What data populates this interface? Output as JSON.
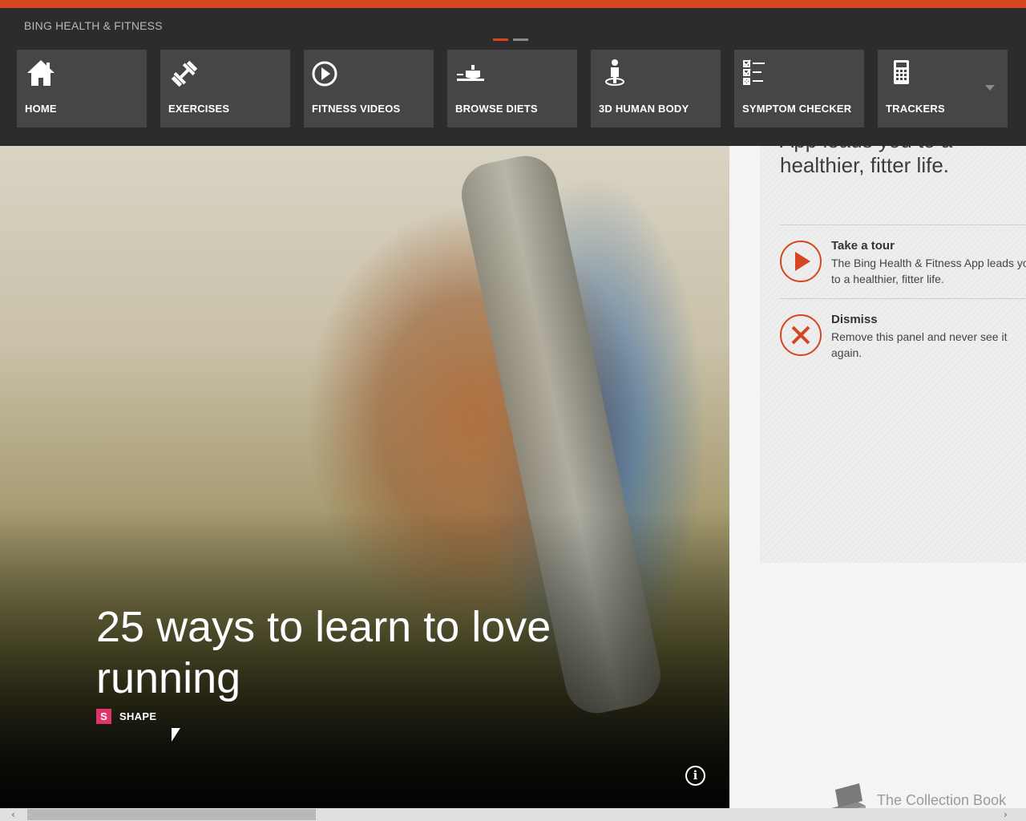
{
  "app": {
    "title": "BING HEALTH & FITNESS"
  },
  "colors": {
    "accent": "#d6451f",
    "appbar": "#2c2c2c",
    "tile": "#464646",
    "source_badge": "#e0336a"
  },
  "nav": {
    "items": [
      {
        "label": "HOME",
        "icon": "home-icon"
      },
      {
        "label": "EXERCISES",
        "icon": "dumbbell-icon"
      },
      {
        "label": "FITNESS VIDEOS",
        "icon": "play-circle-icon"
      },
      {
        "label": "BROWSE DIETS",
        "icon": "food-plate-icon"
      },
      {
        "label": "3D HUMAN BODY",
        "icon": "human-body-icon"
      },
      {
        "label": "SYMPTOM CHECKER",
        "icon": "checklist-icon"
      },
      {
        "label": "TRACKERS",
        "icon": "calculator-icon"
      }
    ],
    "more_icon": "chevron-down-icon"
  },
  "hero": {
    "title": "25 ways to learn to love running",
    "source_badge": "S",
    "source_name": "SHAPE",
    "info_glyph": "i"
  },
  "intro": {
    "text": "App leads you to a healthier, fitter life.",
    "actions": [
      {
        "title": "Take a tour",
        "description": "The Bing Health & Fitness App leads you to a healthier, fitter life.",
        "icon": "play-icon"
      },
      {
        "title": "Dismiss",
        "description": "Remove this panel and never see it again.",
        "icon": "close-icon"
      }
    ]
  },
  "collection": {
    "label": "The Collection Book",
    "icon": "book-icon"
  },
  "scrollbar": {
    "left_arrow": "‹",
    "right_arrow": "›"
  }
}
